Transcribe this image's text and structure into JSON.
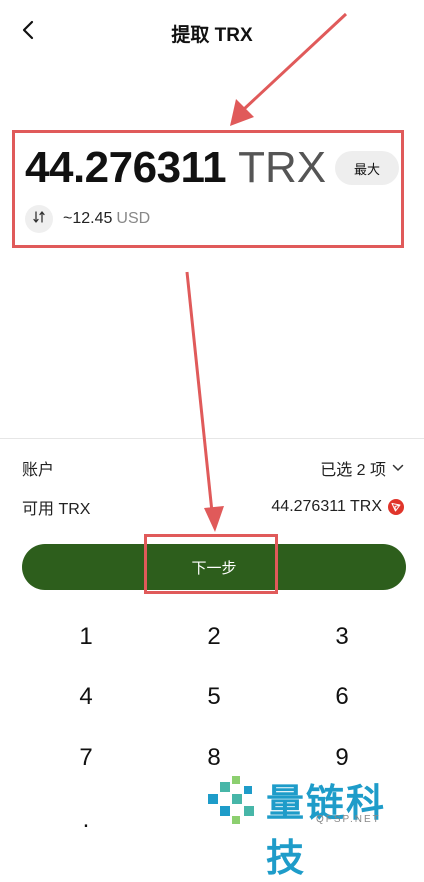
{
  "header": {
    "title": "提取 TRX",
    "back_icon": "chevron-left-icon"
  },
  "amount": {
    "value": "44.276311",
    "unit": "TRX",
    "max_label": "最大",
    "usd_value": "~12.45",
    "usd_unit": "USD",
    "swap_icon": "swap-vertical-icon"
  },
  "account": {
    "label": "账户",
    "selected": "已选 2 项",
    "chevron_icon": "chevron-down-icon"
  },
  "available": {
    "label": "可用 TRX",
    "value": "44.276311 TRX",
    "token_icon": "tron-icon"
  },
  "next_button": {
    "label": "下一步"
  },
  "keypad": {
    "keys": [
      "1",
      "2",
      "3",
      "4",
      "5",
      "6",
      "7",
      "8",
      "9",
      "."
    ]
  },
  "colors": {
    "accent": "#2d5e1c",
    "annotation_red": "#e05a5a",
    "tron_red": "#e0352b",
    "watermark_blue": "#1e9cc9"
  },
  "watermark": {
    "text": "量链科技",
    "sub": "QFSP.NET"
  }
}
